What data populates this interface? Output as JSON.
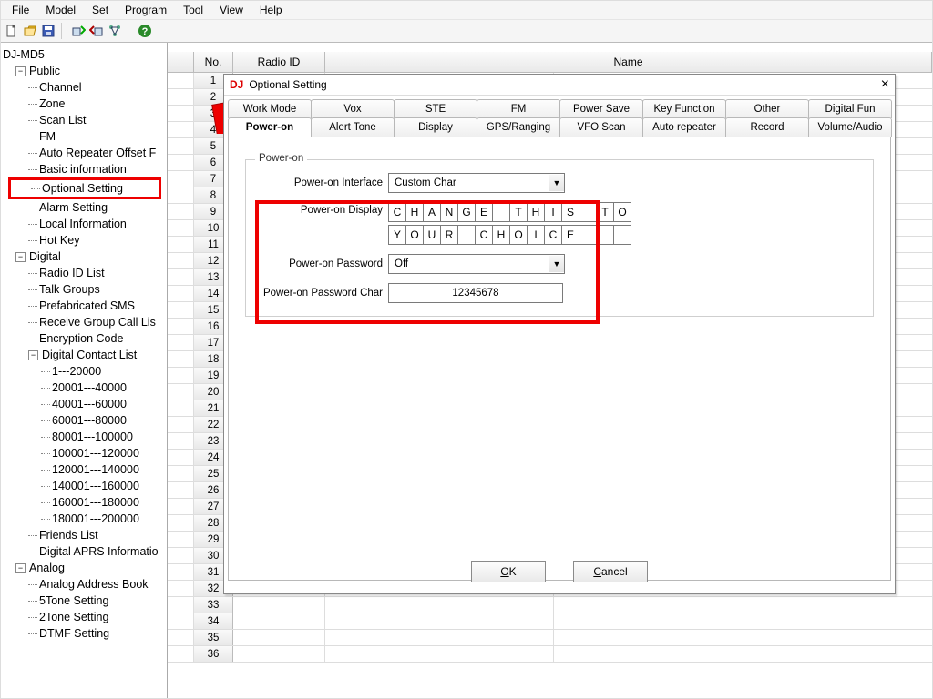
{
  "menubar": {
    "items": [
      "File",
      "Model",
      "Set",
      "Program",
      "Tool",
      "View",
      "Help"
    ]
  },
  "tree": {
    "root": "DJ-MD5",
    "public": {
      "label": "Public",
      "items": [
        "Channel",
        "Zone",
        "Scan List",
        "FM",
        "Auto Repeater Offset F",
        "Basic information",
        "Optional Setting",
        "Alarm Setting",
        "Local Information",
        "Hot Key"
      ]
    },
    "digital": {
      "label": "Digital",
      "items": [
        "Radio ID List",
        "Talk Groups",
        "Prefabricated SMS",
        "Receive Group Call Lis",
        "Encryption Code"
      ],
      "contact": {
        "label": "Digital Contact List",
        "ranges": [
          "1---20000",
          "20001---40000",
          "40001---60000",
          "60001---80000",
          "80001---100000",
          "100001---120000",
          "120001---140000",
          "140001---160000",
          "160001---180000",
          "180001---200000"
        ]
      },
      "tail": [
        "Friends List",
        "Digital APRS Informatio"
      ]
    },
    "analog": {
      "label": "Analog",
      "items": [
        "Analog Address Book",
        "5Tone Setting",
        "2Tone Setting",
        "DTMF Setting"
      ]
    }
  },
  "grid": {
    "headers": {
      "no": "No.",
      "radio": "Radio ID",
      "name": "Name"
    },
    "row_count": 36
  },
  "dialog": {
    "title": "Optional Setting",
    "tabs_row1": [
      "Work Mode",
      "Vox",
      "STE",
      "FM",
      "Power Save",
      "Key Function",
      "Other",
      "Digital Fun"
    ],
    "tabs_row2": [
      "Power-on",
      "Alert Tone",
      "Display",
      "GPS/Ranging",
      "VFO Scan",
      "Auto repeater",
      "Record",
      "Volume/Audio"
    ],
    "active_tab": "Power-on",
    "fieldset_legend": "Power-on",
    "labels": {
      "interface": "Power-on Interface",
      "display": "Power-on Display",
      "password": "Power-on Password",
      "password_char": "Power-on Password Char"
    },
    "interface_value": "Custom Char",
    "display_line1": [
      "C",
      "H",
      "A",
      "N",
      "G",
      "E",
      "",
      "T",
      "H",
      "I",
      "S",
      "",
      "T",
      "O"
    ],
    "display_line2": [
      "Y",
      "O",
      "U",
      "R",
      "",
      "C",
      "H",
      "O",
      "I",
      "C",
      "E",
      "",
      "",
      ""
    ],
    "password_value": "Off",
    "password_char_value": "12345678",
    "buttons": {
      "ok": "OK",
      "cancel": "Cancel"
    }
  }
}
